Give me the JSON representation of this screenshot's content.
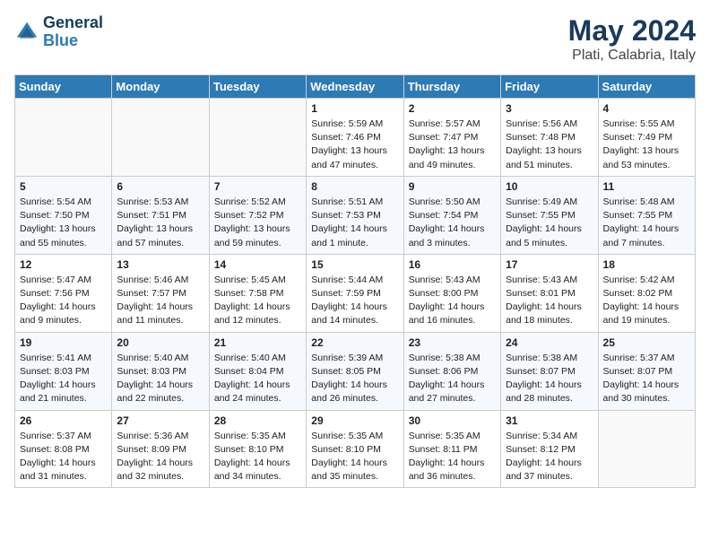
{
  "header": {
    "logo_line1": "General",
    "logo_line2": "Blue",
    "title": "May 2024",
    "subtitle": "Plati, Calabria, Italy"
  },
  "days_of_week": [
    "Sunday",
    "Monday",
    "Tuesday",
    "Wednesday",
    "Thursday",
    "Friday",
    "Saturday"
  ],
  "weeks": [
    {
      "shade": false,
      "days": [
        {
          "number": "",
          "info": ""
        },
        {
          "number": "",
          "info": ""
        },
        {
          "number": "",
          "info": ""
        },
        {
          "number": "1",
          "info": "Sunrise: 5:59 AM\nSunset: 7:46 PM\nDaylight: 13 hours\nand 47 minutes."
        },
        {
          "number": "2",
          "info": "Sunrise: 5:57 AM\nSunset: 7:47 PM\nDaylight: 13 hours\nand 49 minutes."
        },
        {
          "number": "3",
          "info": "Sunrise: 5:56 AM\nSunset: 7:48 PM\nDaylight: 13 hours\nand 51 minutes."
        },
        {
          "number": "4",
          "info": "Sunrise: 5:55 AM\nSunset: 7:49 PM\nDaylight: 13 hours\nand 53 minutes."
        }
      ]
    },
    {
      "shade": true,
      "days": [
        {
          "number": "5",
          "info": "Sunrise: 5:54 AM\nSunset: 7:50 PM\nDaylight: 13 hours\nand 55 minutes."
        },
        {
          "number": "6",
          "info": "Sunrise: 5:53 AM\nSunset: 7:51 PM\nDaylight: 13 hours\nand 57 minutes."
        },
        {
          "number": "7",
          "info": "Sunrise: 5:52 AM\nSunset: 7:52 PM\nDaylight: 13 hours\nand 59 minutes."
        },
        {
          "number": "8",
          "info": "Sunrise: 5:51 AM\nSunset: 7:53 PM\nDaylight: 14 hours\nand 1 minute."
        },
        {
          "number": "9",
          "info": "Sunrise: 5:50 AM\nSunset: 7:54 PM\nDaylight: 14 hours\nand 3 minutes."
        },
        {
          "number": "10",
          "info": "Sunrise: 5:49 AM\nSunset: 7:55 PM\nDaylight: 14 hours\nand 5 minutes."
        },
        {
          "number": "11",
          "info": "Sunrise: 5:48 AM\nSunset: 7:55 PM\nDaylight: 14 hours\nand 7 minutes."
        }
      ]
    },
    {
      "shade": false,
      "days": [
        {
          "number": "12",
          "info": "Sunrise: 5:47 AM\nSunset: 7:56 PM\nDaylight: 14 hours\nand 9 minutes."
        },
        {
          "number": "13",
          "info": "Sunrise: 5:46 AM\nSunset: 7:57 PM\nDaylight: 14 hours\nand 11 minutes."
        },
        {
          "number": "14",
          "info": "Sunrise: 5:45 AM\nSunset: 7:58 PM\nDaylight: 14 hours\nand 12 minutes."
        },
        {
          "number": "15",
          "info": "Sunrise: 5:44 AM\nSunset: 7:59 PM\nDaylight: 14 hours\nand 14 minutes."
        },
        {
          "number": "16",
          "info": "Sunrise: 5:43 AM\nSunset: 8:00 PM\nDaylight: 14 hours\nand 16 minutes."
        },
        {
          "number": "17",
          "info": "Sunrise: 5:43 AM\nSunset: 8:01 PM\nDaylight: 14 hours\nand 18 minutes."
        },
        {
          "number": "18",
          "info": "Sunrise: 5:42 AM\nSunset: 8:02 PM\nDaylight: 14 hours\nand 19 minutes."
        }
      ]
    },
    {
      "shade": true,
      "days": [
        {
          "number": "19",
          "info": "Sunrise: 5:41 AM\nSunset: 8:03 PM\nDaylight: 14 hours\nand 21 minutes."
        },
        {
          "number": "20",
          "info": "Sunrise: 5:40 AM\nSunset: 8:03 PM\nDaylight: 14 hours\nand 22 minutes."
        },
        {
          "number": "21",
          "info": "Sunrise: 5:40 AM\nSunset: 8:04 PM\nDaylight: 14 hours\nand 24 minutes."
        },
        {
          "number": "22",
          "info": "Sunrise: 5:39 AM\nSunset: 8:05 PM\nDaylight: 14 hours\nand 26 minutes."
        },
        {
          "number": "23",
          "info": "Sunrise: 5:38 AM\nSunset: 8:06 PM\nDaylight: 14 hours\nand 27 minutes."
        },
        {
          "number": "24",
          "info": "Sunrise: 5:38 AM\nSunset: 8:07 PM\nDaylight: 14 hours\nand 28 minutes."
        },
        {
          "number": "25",
          "info": "Sunrise: 5:37 AM\nSunset: 8:07 PM\nDaylight: 14 hours\nand 30 minutes."
        }
      ]
    },
    {
      "shade": false,
      "days": [
        {
          "number": "26",
          "info": "Sunrise: 5:37 AM\nSunset: 8:08 PM\nDaylight: 14 hours\nand 31 minutes."
        },
        {
          "number": "27",
          "info": "Sunrise: 5:36 AM\nSunset: 8:09 PM\nDaylight: 14 hours\nand 32 minutes."
        },
        {
          "number": "28",
          "info": "Sunrise: 5:35 AM\nSunset: 8:10 PM\nDaylight: 14 hours\nand 34 minutes."
        },
        {
          "number": "29",
          "info": "Sunrise: 5:35 AM\nSunset: 8:10 PM\nDaylight: 14 hours\nand 35 minutes."
        },
        {
          "number": "30",
          "info": "Sunrise: 5:35 AM\nSunset: 8:11 PM\nDaylight: 14 hours\nand 36 minutes."
        },
        {
          "number": "31",
          "info": "Sunrise: 5:34 AM\nSunset: 8:12 PM\nDaylight: 14 hours\nand 37 minutes."
        },
        {
          "number": "",
          "info": ""
        }
      ]
    }
  ]
}
